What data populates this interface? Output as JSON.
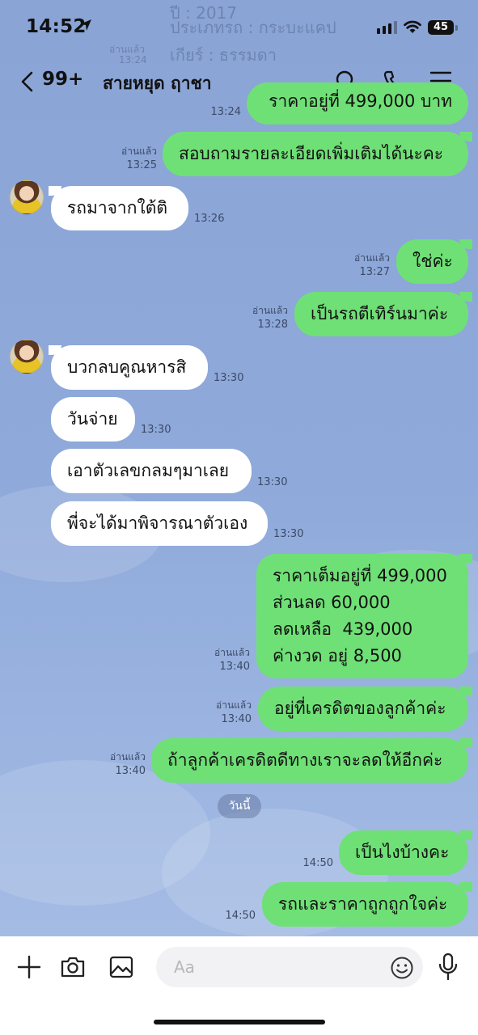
{
  "status_bar": {
    "time": "14:52",
    "battery": "45"
  },
  "header": {
    "back_count": "99+",
    "title": "สายหยุด ฤาชา"
  },
  "partial_previous": {
    "line1": "ปี : 2017",
    "line2": "ประเภทรถ : กระบะแคป",
    "line3": "เกียร์ : ธรรมดา",
    "line4": "ราคาอยู่ที่ 499,000 บาท",
    "meta_read": "อ่านแล้ว",
    "meta_time": "13:24"
  },
  "messages": [
    {
      "dir": "out",
      "text": "สอบถามรายละเอียดเพิ่มเติมได้นะคะ",
      "read": "อ่านแล้ว",
      "time": "13:25"
    },
    {
      "dir": "in",
      "text": "รถมาจากใต้ติ",
      "time": "13:26"
    },
    {
      "dir": "out",
      "text": "ใช่ค่ะ",
      "read": "อ่านแล้ว",
      "time": "13:27"
    },
    {
      "dir": "out",
      "text": "เป็นรถตีเทิร์นมาค่ะ",
      "read": "อ่านแล้ว",
      "time": "13:28"
    },
    {
      "dir": "in",
      "text": "บวกลบคูณหารสิ",
      "time": "13:30"
    },
    {
      "dir": "in",
      "text": "วันจ่าย",
      "time": "13:30"
    },
    {
      "dir": "in",
      "text": "เอาตัวเลขกลมๆมาเลย",
      "time": "13:30"
    },
    {
      "dir": "in",
      "text": "พี่จะได้มาพิจารณาตัวเอง",
      "time": "13:30"
    },
    {
      "dir": "out",
      "lines": [
        "ราคาเต็มอยู่ที่ 499,000",
        "ส่วนลด 60,000",
        "ลดเหลือ  439,000",
        "ค่างวด อยู่ 8,500"
      ],
      "read": "อ่านแล้ว",
      "time": "13:40"
    },
    {
      "dir": "out",
      "text": "อยู่ที่เครดิตของลูกค้าค่ะ",
      "read": "อ่านแล้ว",
      "time": "13:40"
    },
    {
      "dir": "out",
      "text": "ถ้าลูกค้าเครดิตดีทางเราจะลดให้อีกค่ะ",
      "read": "อ่านแล้ว",
      "time": "13:40"
    },
    {
      "dir": "out",
      "text": "เป็นไงบ้างคะ",
      "time": "14:50"
    },
    {
      "dir": "out",
      "text": "รถและราคาถูกถูกใจค่ะ",
      "time": "14:50"
    }
  ],
  "date_separator": "วันนี้",
  "input": {
    "placeholder": "Aa"
  },
  "colors": {
    "outgoing_bubble": "#6fe076",
    "incoming_bubble": "#ffffff",
    "background": "#8ea9da"
  },
  "icons": [
    "location-arrow-icon",
    "signal-icon",
    "wifi-icon",
    "battery-icon",
    "back-chevron-icon",
    "search-icon",
    "phone-icon",
    "menu-icon",
    "plus-icon",
    "camera-icon",
    "image-icon",
    "emoji-icon",
    "microphone-icon"
  ]
}
